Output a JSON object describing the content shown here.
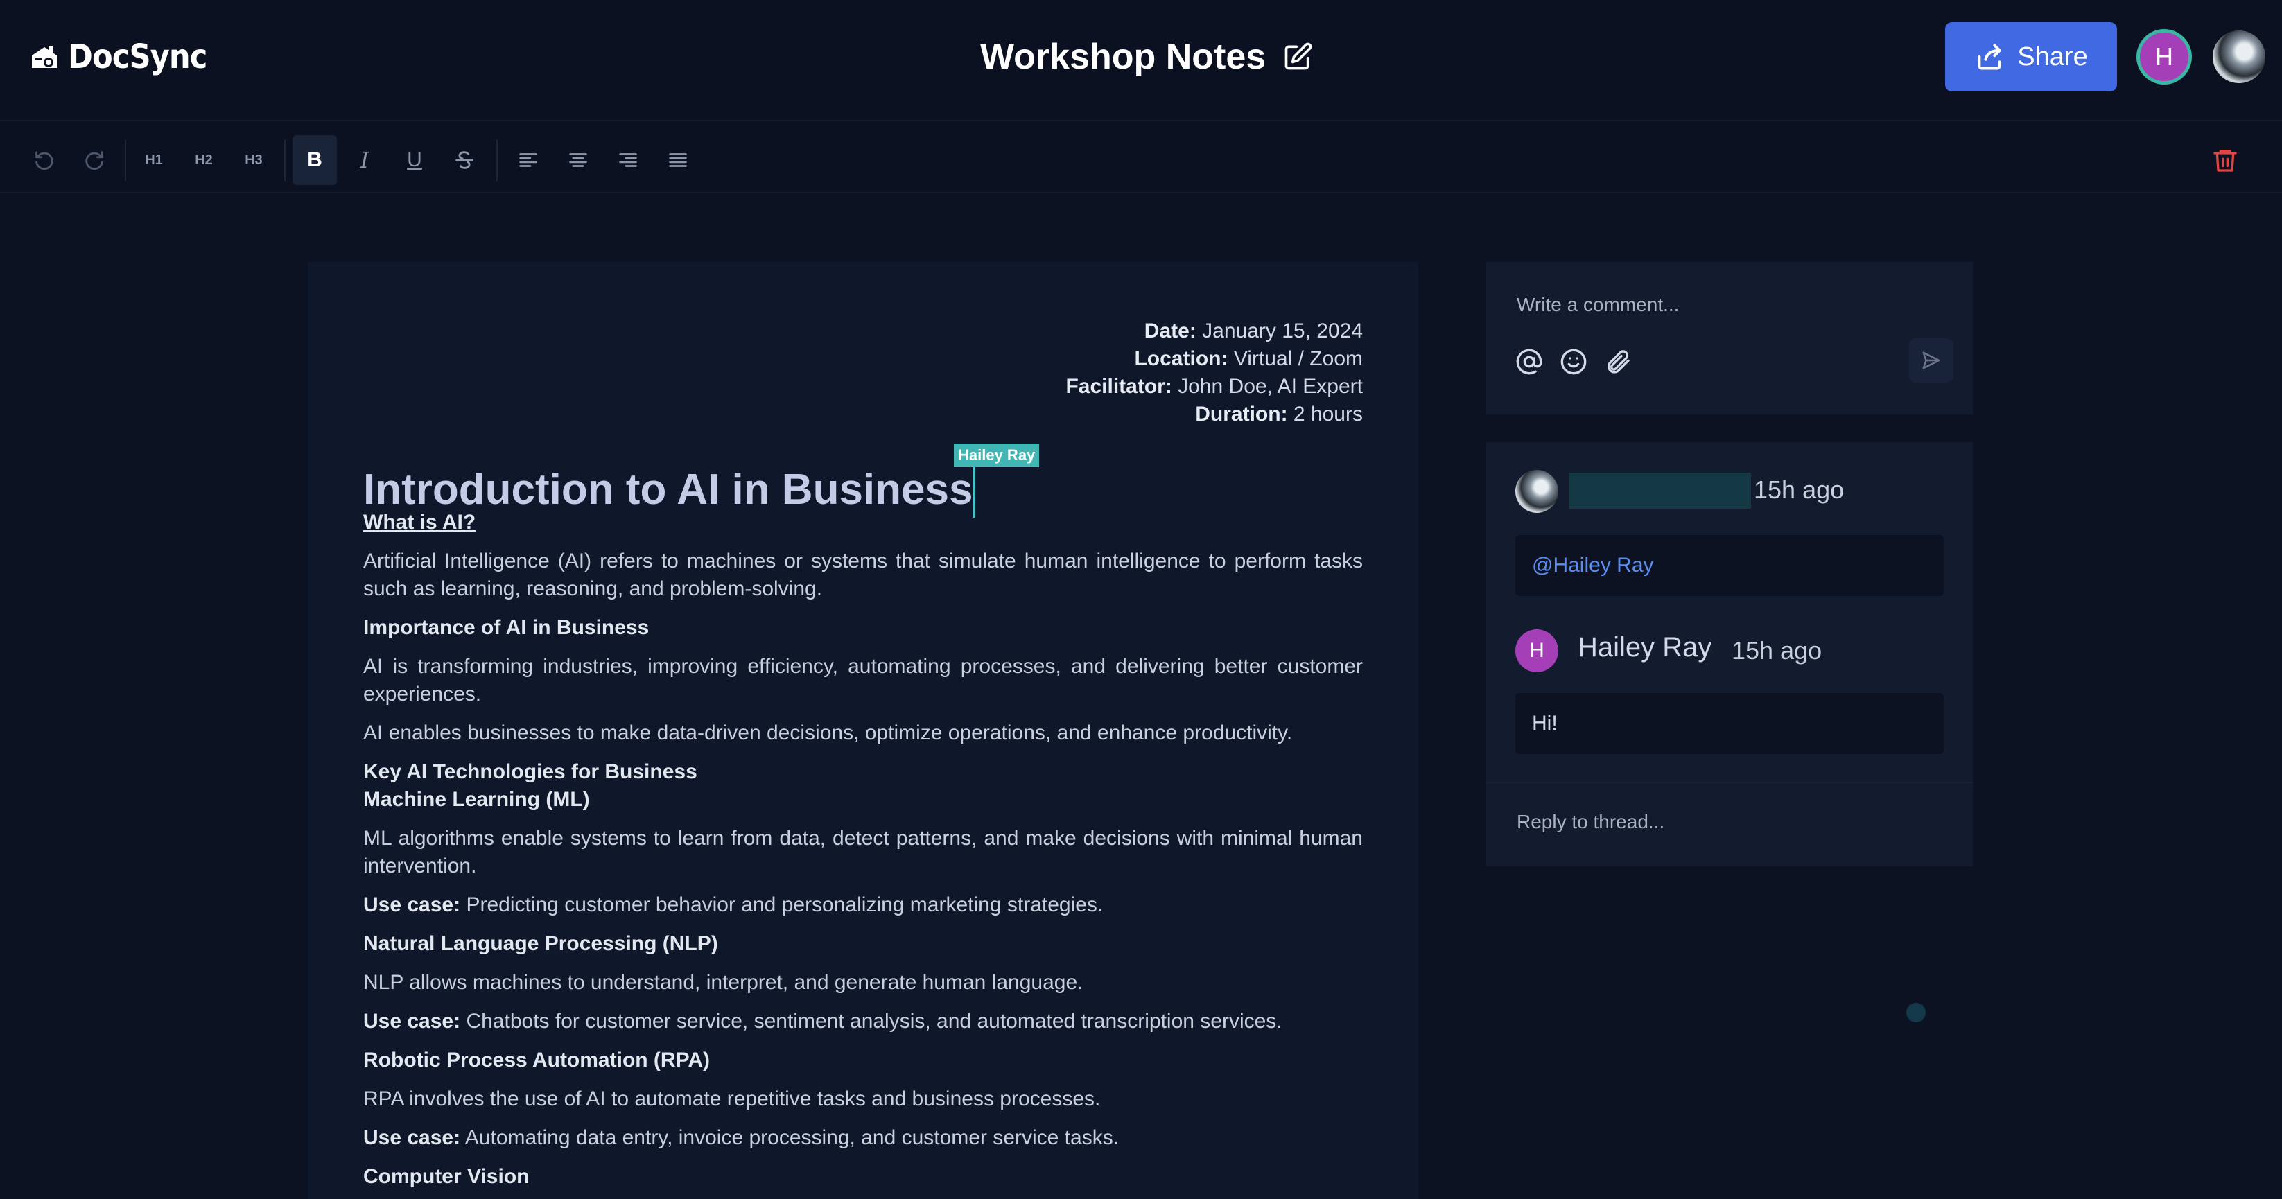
{
  "app": {
    "name": "DocSync"
  },
  "header": {
    "doc_title": "Workshop Notes",
    "share_label": "Share",
    "user_initial": "H"
  },
  "toolbar": {
    "h1": "H1",
    "h2": "H2",
    "h3": "H3",
    "bold": "B",
    "italic": "I",
    "underline": "U"
  },
  "document": {
    "meta": [
      {
        "label": "Date:",
        "value": "January 15, 2024"
      },
      {
        "label": "Location:",
        "value": "Virtual / Zoom"
      },
      {
        "label": "Facilitator:",
        "value": "John Doe, AI Expert"
      },
      {
        "label": "Duration:",
        "value": "2 hours"
      }
    ],
    "collaborator_tag": "Hailey Ray",
    "title": "Introduction to AI in Business",
    "s1_heading": "What is AI?",
    "s1_p1": "Artificial Intelligence (AI) refers to machines or systems that simulate human intelligence to perform tasks such as learning, reasoning, and problem-solving.",
    "s2_heading": "Importance of AI in Business",
    "s2_p1": "AI is transforming industries, improving efficiency, automating processes, and delivering better customer experiences.",
    "s2_p2": "AI enables businesses to make data-driven decisions, optimize operations, and enhance productivity.",
    "s3_heading": "Key AI Technologies for Business",
    "ml_heading": "Machine Learning (ML)",
    "ml_p": "ML algorithms enable systems to learn from data, detect patterns, and make decisions with minimal human intervention.",
    "use_case_label": "Use case:",
    "ml_use": "Predicting customer behavior and personalizing marketing strategies.",
    "nlp_heading": "Natural Language Processing (NLP)",
    "nlp_p": "NLP allows machines to understand, interpret, and generate human language.",
    "nlp_use": "Chatbots for customer service, sentiment analysis, and automated transcription services.",
    "rpa_heading": "Robotic Process Automation (RPA)",
    "rpa_p": "RPA involves the use of AI to automate repetitive tasks and business processes.",
    "rpa_use": "Automating data entry, invoice processing, and customer service tasks.",
    "cv_heading": "Computer Vision"
  },
  "comments": {
    "input_placeholder": "Write a comment...",
    "thread": [
      {
        "time": "15h ago",
        "body": "@Hailey Ray"
      },
      {
        "author": "Hailey Ray",
        "initial": "H",
        "time": "15h ago",
        "body": "Hi!"
      }
    ],
    "reply_placeholder": "Reply to thread..."
  }
}
